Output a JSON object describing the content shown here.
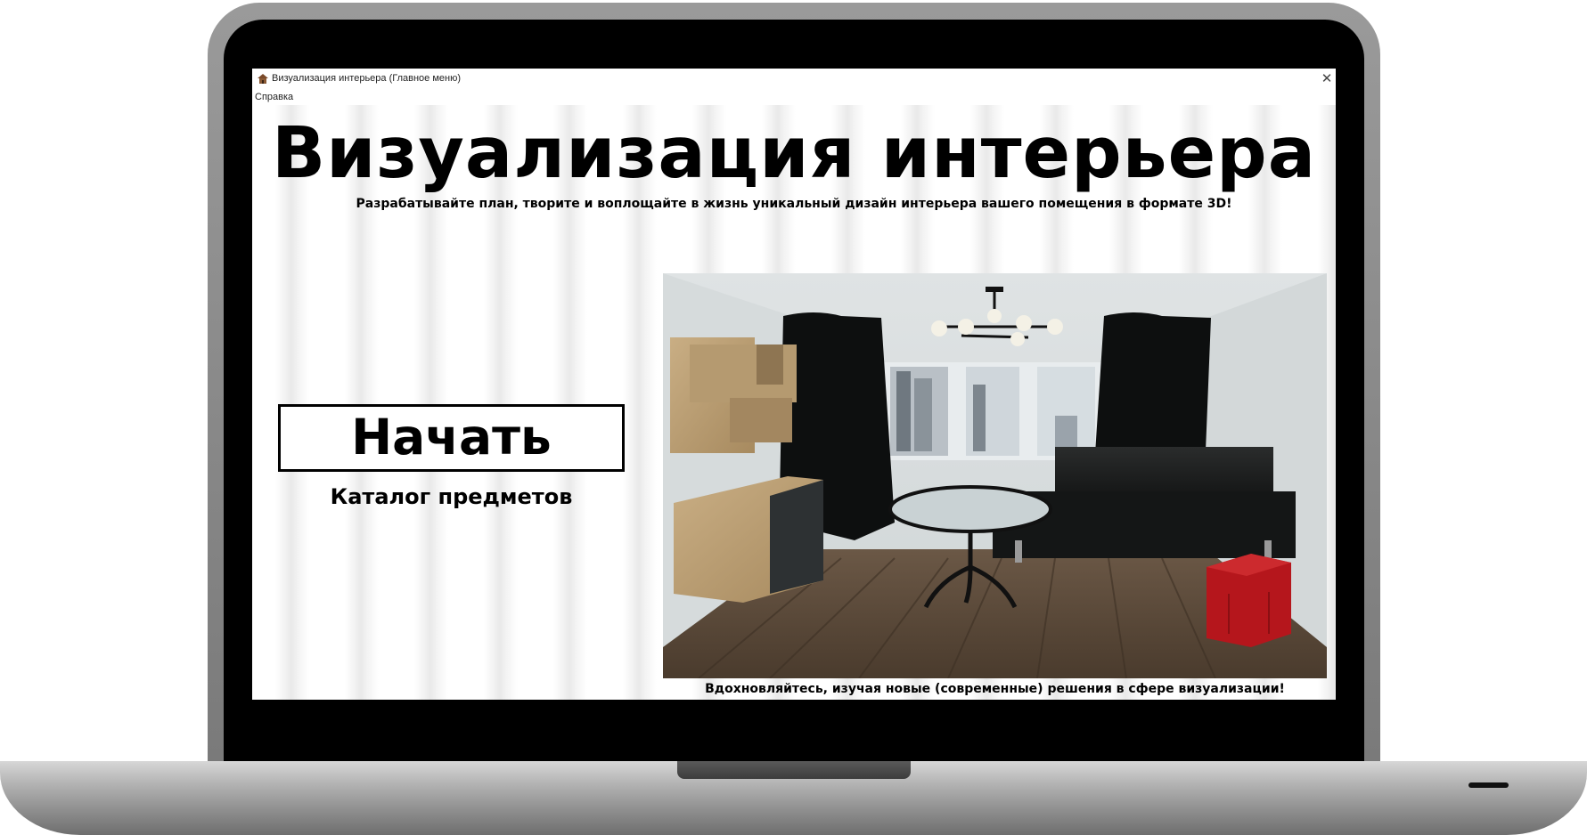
{
  "window": {
    "title": "Визуализация интерьера (Главное меню)",
    "close_glyph": "✕"
  },
  "menu": {
    "items": [
      {
        "label": "Справка"
      }
    ]
  },
  "main": {
    "heading": "Визуализация интерьера",
    "subheading": "Разрабатывайте план, творите и воплощайте в жизнь уникальный дизайн интерьера вашего помещения в формате 3D!",
    "start_label": "Начать",
    "catalog_label": "Каталог предметов",
    "caption": "Вдохновляйтесь, изучая новые (современные) решения в сфере визуализации!"
  },
  "icons": {
    "app": "house-icon",
    "close": "close-icon",
    "preview": "room-preview-image"
  },
  "colors": {
    "text": "#000000",
    "window_bg": "#ffffff",
    "laptop_frame": "#8a8a8a",
    "curtain": "#0d0f0f",
    "floor": "#5a4a3a",
    "pouf": "#b5161c"
  }
}
